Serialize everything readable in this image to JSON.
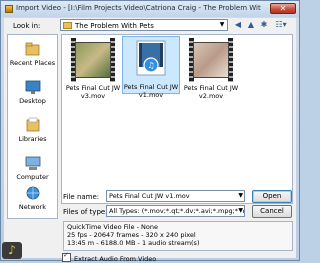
{
  "window": {
    "title": "Import Video - [I:\\Film Projects Video\\Catriona Craig - The Problem With Pets\\The Proble..."
  },
  "lookin": {
    "label": "Look in:",
    "value": "The Problem With Pets"
  },
  "sidebar": {
    "items": [
      {
        "label": "Recent Places",
        "icon": "recent-places-icon"
      },
      {
        "label": "Desktop",
        "icon": "desktop-icon"
      },
      {
        "label": "Libraries",
        "icon": "libraries-icon"
      },
      {
        "label": "Computer",
        "icon": "computer-icon"
      },
      {
        "label": "Network",
        "icon": "network-icon"
      }
    ]
  },
  "files": [
    {
      "line1": "Pets Final Cut JW",
      "line2": "v3.mov",
      "selected": false
    },
    {
      "line1": "Pets Final Cut JW",
      "line2": "v1.mov",
      "selected": true
    },
    {
      "line1": "Pets Final Cut JW",
      "line2": "v2.mov",
      "selected": false
    }
  ],
  "filename": {
    "label": "File name:",
    "value": "Pets Final Cut JW v1.mov"
  },
  "filetype": {
    "label": "Files of type:",
    "value": "All Types: (*.mov;*.qt;*.dv;*.avi;*.mpg;*.mpeg;*.r"
  },
  "buttons": {
    "open": "Open",
    "cancel": "Cancel"
  },
  "info": {
    "line1": "QuickTime Video File - None",
    "line2": "25 fps - 20647 frames - 320 x 240 pixel",
    "line3": "13:45 m - 6188.0 MB - 1 audio stream(s)"
  },
  "extract": {
    "label": "Extract Audio From Video",
    "checked": true
  },
  "badge": {
    "letter": "♪"
  }
}
